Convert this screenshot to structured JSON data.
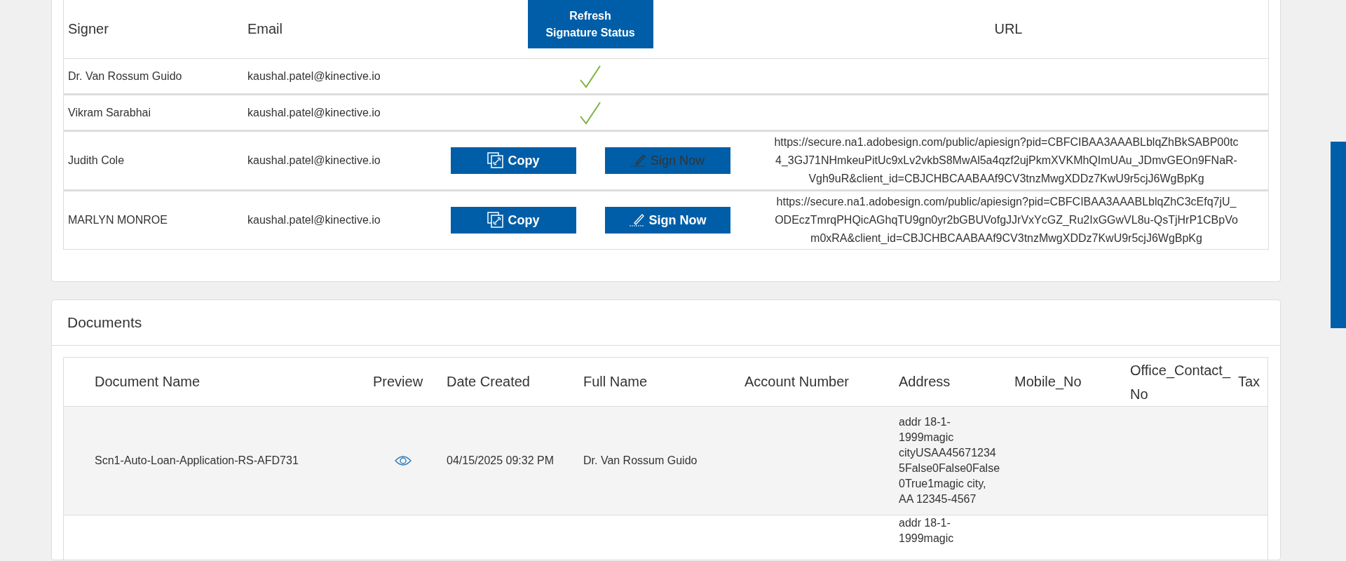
{
  "signers": {
    "columns": [
      "Signer",
      "Email",
      "URL"
    ],
    "refresh_button": "Refresh Signature Status",
    "rows": [
      {
        "signer": "Dr. Van Rossum Guido",
        "email": "kaushal.patel@kinective.io",
        "signed": true
      },
      {
        "signer": "Vikram Sarabhai",
        "email": "kaushal.patel@kinective.io",
        "signed": true
      },
      {
        "signer": "Judith Cole",
        "email": "kaushal.patel@kinective.io",
        "signed": false,
        "copy_button": "Copy",
        "sign_button": {
          "label": "Sign Now",
          "disabled": true
        },
        "url": "https://secure.na1.adobesign.com/public/apiesign?pid=CBFCIBAA3AAABLblqZhBkSABP00tc4_3GJ71NHmkeuPitUc9xLv2vkbS8MwAl5a4qzf2ujPkmXVKMhQImUAu_JDmvGEOn9FNaR-Vgh9uR&client_id=CBJCHBCAABAAf9CV3tnzMwgXDDz7KwU9r5cjJ6WgBpKg"
      },
      {
        "signer": "MARLYN MONROE",
        "email": "kaushal.patel@kinective.io",
        "signed": false,
        "copy_button": "Copy",
        "sign_button": {
          "label": "Sign Now",
          "disabled": false
        },
        "url": "https://secure.na1.adobesign.com/public/apiesign?pid=CBFCIBAA3AAABLblqZhC3cEfq7jU_ODEczTmrqPHQicAGhqTU9gn0yr2bGBUVofgJJrVxYcGZ_Ru2IxGGwVL8u-QsTjHrP1CBpVom0xRA&client_id=CBJCHBCAABAAf9CV3tnzMwgXDDz7KwU9r5cjJ6WgBpKg"
      }
    ]
  },
  "documents": {
    "title": "Documents",
    "columns": [
      "Document Name",
      "Preview",
      "Date Created",
      "Full Name",
      "Account Number",
      "Address",
      "Mobile_No",
      "Office_Contact_No",
      "Tax"
    ],
    "rows": [
      {
        "document_name": "Scn1-Auto-Loan-Application-RS-AFD731",
        "preview": true,
        "date_created": "04/15/2025 09:32 PM",
        "full_name": "Dr. Van Rossum Guido",
        "address": "addr 18-1-1999magic cityUSAA456712345False0False0False0True1magic city, AA 12345-4567"
      },
      {
        "address": "addr 18-1-1999magic"
      }
    ]
  }
}
